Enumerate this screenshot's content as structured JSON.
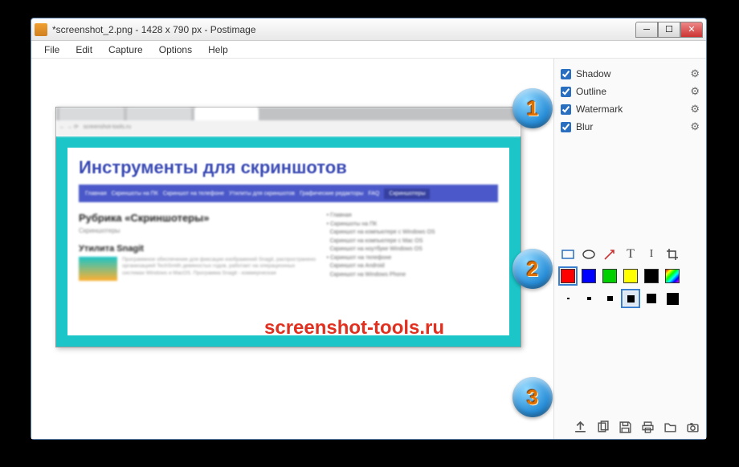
{
  "window": {
    "title": "*screenshot_2.png - 1428 x 790 px - Postimage"
  },
  "menubar": {
    "items": [
      "File",
      "Edit",
      "Capture",
      "Options",
      "Help"
    ]
  },
  "effects": {
    "items": [
      {
        "label": "Shadow",
        "checked": true
      },
      {
        "label": "Outline",
        "checked": true
      },
      {
        "label": "Watermark",
        "checked": true
      },
      {
        "label": "Blur",
        "checked": true
      }
    ]
  },
  "tools": {
    "shapes": [
      "rectangle",
      "ellipse",
      "arrow",
      "text",
      "line",
      "crop"
    ],
    "colors": [
      "#ff0000",
      "#0000ff",
      "#00d000",
      "#ffff00",
      "#000000",
      "rainbow"
    ],
    "selected_color_index": 0,
    "thickness": [
      2,
      4,
      6,
      10,
      13,
      16
    ],
    "selected_thickness_index": 3
  },
  "actions": [
    "upload",
    "copy",
    "save",
    "print",
    "open-folder",
    "camera"
  ],
  "canvas": {
    "page_title": "Инструменты для скриншотов",
    "nav_items": [
      "Главная",
      "Скриншоты на ПК",
      "Скриншот на телефоне",
      "Утилиты для скриншотов",
      "Графические редакторы",
      "FAQ",
      "Скриншотеры"
    ],
    "section_title": "Рубрика «Скриншотеры»",
    "section_sub": "Скриншотеры",
    "article_title": "Утилита Snagit",
    "article_body": "Программное обеспечение для фиксации изображений Snagit, распространено организацией TechSmith девяностых годов, работает на операционных системах Windows и MacOS. Программа Snagit - коммерческая",
    "sidebar_links": [
      "Главная",
      "Скриншоты на ПК",
      "Скриншот на компьютере с Windows OS",
      "Скриншот на компьютере с Mac OS",
      "Скриншот на ноутбуке Windows OS",
      "Скриншот на телефоне",
      "Скриншот на Android",
      "Скриншот на Windows Phone"
    ]
  },
  "watermark_text": "screenshot-tools.ru",
  "callouts": {
    "c1": "1",
    "c2": "2",
    "c3": "3"
  }
}
